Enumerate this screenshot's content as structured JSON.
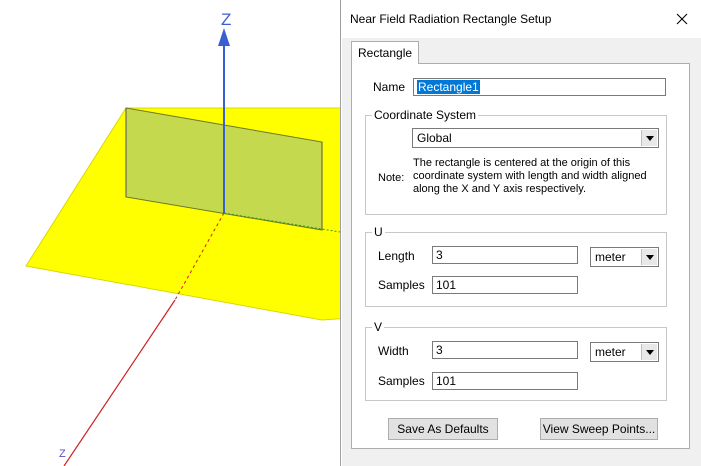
{
  "viewport": {
    "axis_top_label": "Z",
    "axis_bottom_label": "Z",
    "colors": {
      "plane": "#ffff00",
      "rect": "#c5d94e",
      "axis_z": "#3a5fd0",
      "axis_x": "#d02020"
    }
  },
  "dialog": {
    "title": "Near Field Radiation Rectangle Setup",
    "tab_label": "Rectangle",
    "name_label": "Name",
    "name_value": "Rectangle1",
    "coord_group_title": "Coordinate System",
    "coord_value": "Global",
    "note_label": "Note:",
    "note_text": "The rectangle is centered at the origin of this coordinate system with length and width aligned along the X and Y axis respectively.",
    "u_group_title": "U",
    "length_label": "Length",
    "length_value": "3",
    "length_unit": "meter",
    "u_samples_label": "Samples",
    "u_samples_value": "101",
    "v_group_title": "V",
    "width_label": "Width",
    "width_value": "3",
    "width_unit": "meter",
    "v_samples_label": "Samples",
    "v_samples_value": "101",
    "save_defaults_label": "Save As Defaults",
    "view_sweep_label": "View Sweep Points..."
  }
}
